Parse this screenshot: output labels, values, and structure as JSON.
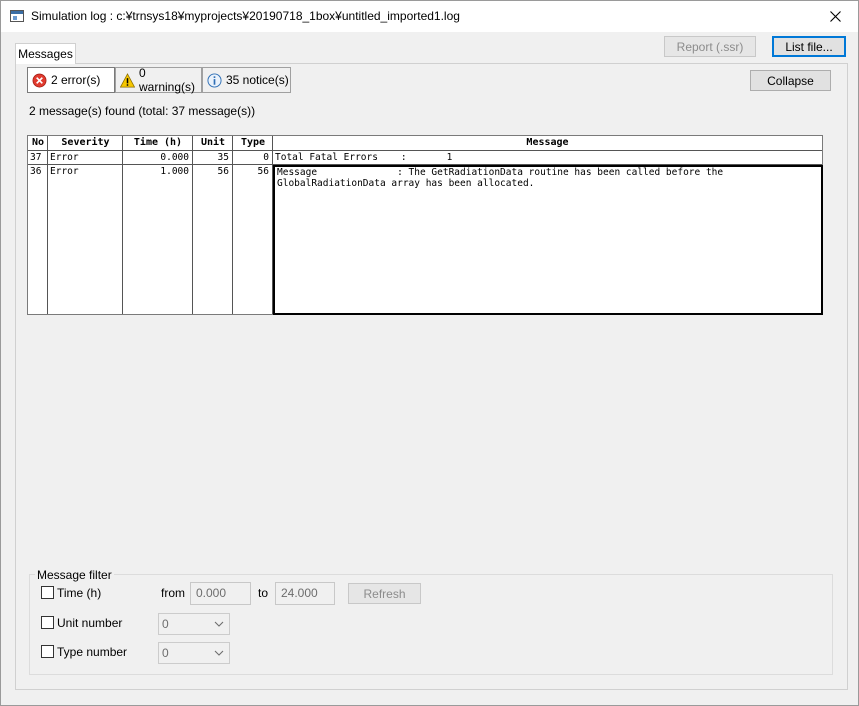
{
  "window": {
    "title": "Simulation log : c:¥trnsys18¥myprojects¥20190718_1box¥untitled_imported1.log"
  },
  "tabs": [
    {
      "label": "Messages"
    }
  ],
  "toolbar": {
    "report_label": "Report (.ssr)",
    "list_file_label": "List file...",
    "collapse_label": "Collapse"
  },
  "filters": {
    "errors": "2 error(s)",
    "warnings": "0 warning(s)",
    "notices": "35 notice(s)"
  },
  "summary": "2 message(s) found (total: 37 message(s))",
  "table": {
    "headers": {
      "no": "No",
      "severity": "Severity",
      "time": "Time (h)",
      "unit": "Unit",
      "type": "Type",
      "message": "Message"
    },
    "rows": [
      {
        "no": "37",
        "severity": "Error",
        "time": "0.000",
        "unit": "35",
        "type": "0",
        "message": "Total Fatal Errors    :       1"
      },
      {
        "no": "36",
        "severity": "Error",
        "time": "1.000",
        "unit": "56",
        "type": "56",
        "message": "Message              : The GetRadiationData routine has been called before the GlobalRadiationData array has been allocated."
      }
    ]
  },
  "message_filter": {
    "legend": "Message filter",
    "time_label": "Time (h)",
    "from_label": "from",
    "from_value": "0.000",
    "to_label": "to",
    "to_value": "24.000",
    "refresh_label": "Refresh",
    "unit_label": "Unit number",
    "unit_value": "0",
    "type_label": "Type number",
    "type_value": "0"
  },
  "colors": {
    "error": "#e03a2e",
    "warning": "#f6c700",
    "notice": "#2f6fb5",
    "focus": "#0078d7"
  }
}
